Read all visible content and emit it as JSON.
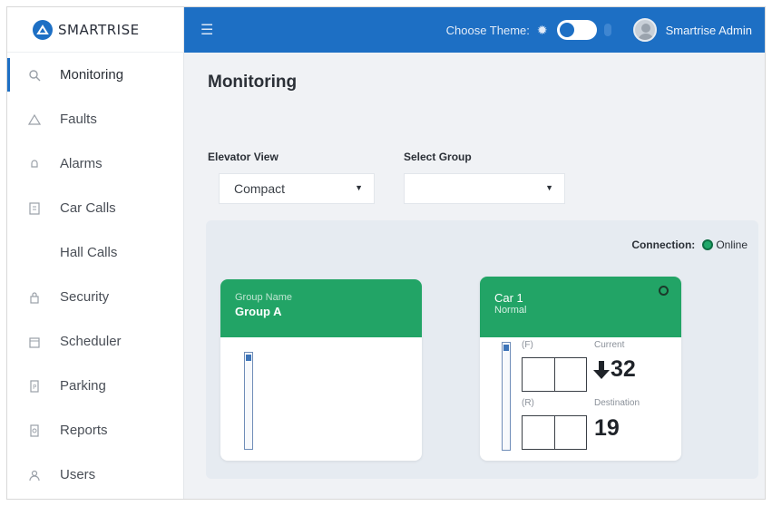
{
  "app": {
    "brand": "SMARTRISE"
  },
  "sidebar": {
    "items": [
      {
        "label": "Monitoring",
        "icon": "search-icon",
        "active": true
      },
      {
        "label": "Faults",
        "icon": "warning-icon",
        "active": false
      },
      {
        "label": "Alarms",
        "icon": "bell-icon",
        "active": false
      },
      {
        "label": "Car Calls",
        "icon": "car-call-icon",
        "active": false
      },
      {
        "label": "Hall Calls",
        "icon": "hall-call-icon",
        "active": false
      },
      {
        "label": "Security",
        "icon": "lock-icon",
        "active": false
      },
      {
        "label": "Scheduler",
        "icon": "calendar-icon",
        "active": false
      },
      {
        "label": "Parking",
        "icon": "parking-icon",
        "active": false
      },
      {
        "label": "Reports",
        "icon": "report-icon",
        "active": false
      },
      {
        "label": "Users",
        "icon": "user-icon",
        "active": false
      }
    ]
  },
  "topbar": {
    "menu_icon": "hamburger-icon",
    "theme_label": "Choose Theme:",
    "theme_toggle_state": "light",
    "user_name": "Smartrise Admin"
  },
  "main": {
    "title": "Monitoring",
    "elevator_view": {
      "label": "Elevator View",
      "value": "Compact"
    },
    "select_group": {
      "label": "Select Group",
      "value": ""
    },
    "connection": {
      "label": "Connection:",
      "status": "Online",
      "status_color": "#20a86a"
    },
    "group_card": {
      "caption": "Group Name",
      "name": "Group A"
    },
    "car_card": {
      "name": "Car 1",
      "mode": "Normal",
      "front_label": "(F)",
      "rear_label": "(R)",
      "current_label": "Current",
      "current_floor": "32",
      "direction": "down",
      "destination_label": "Destination",
      "destination_floor": "19"
    }
  },
  "colors": {
    "brand_blue": "#1d6fc4",
    "card_green": "#22a466"
  }
}
